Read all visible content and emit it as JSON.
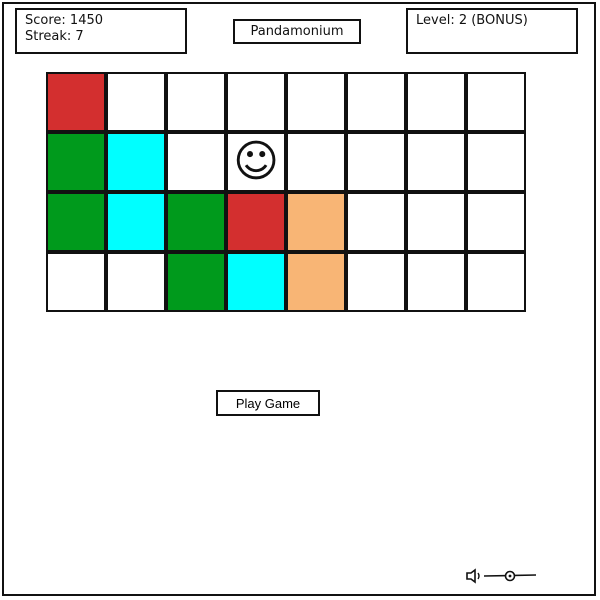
{
  "stats": {
    "score_label": "Score: 1450",
    "streak_label": "Streak: 7"
  },
  "level": {
    "label": "Level: 2 (BONUS)"
  },
  "title": "Pandamonium",
  "play_button": "Play Game",
  "board": {
    "cols": 8,
    "rows": 4,
    "colors": {
      "R": "#d32f2f",
      "G": "#009a1c",
      "C": "#00ffff",
      "O": "#f8b575",
      "W": "#ffffff"
    },
    "cells": [
      [
        "R",
        "W",
        "W",
        "W",
        "W",
        "W",
        "W",
        "W"
      ],
      [
        "G",
        "C",
        "W",
        "S",
        "W",
        "W",
        "W",
        "W"
      ],
      [
        "G",
        "C",
        "G",
        "R",
        "O",
        "W",
        "W",
        "W"
      ],
      [
        "W",
        "W",
        "G",
        "C",
        "O",
        "W",
        "W",
        "W"
      ]
    ],
    "player_icon": "smiley-face-icon",
    "player_glyph": "☺"
  },
  "volume": {
    "icon": "speaker-icon",
    "level": 0.5
  }
}
